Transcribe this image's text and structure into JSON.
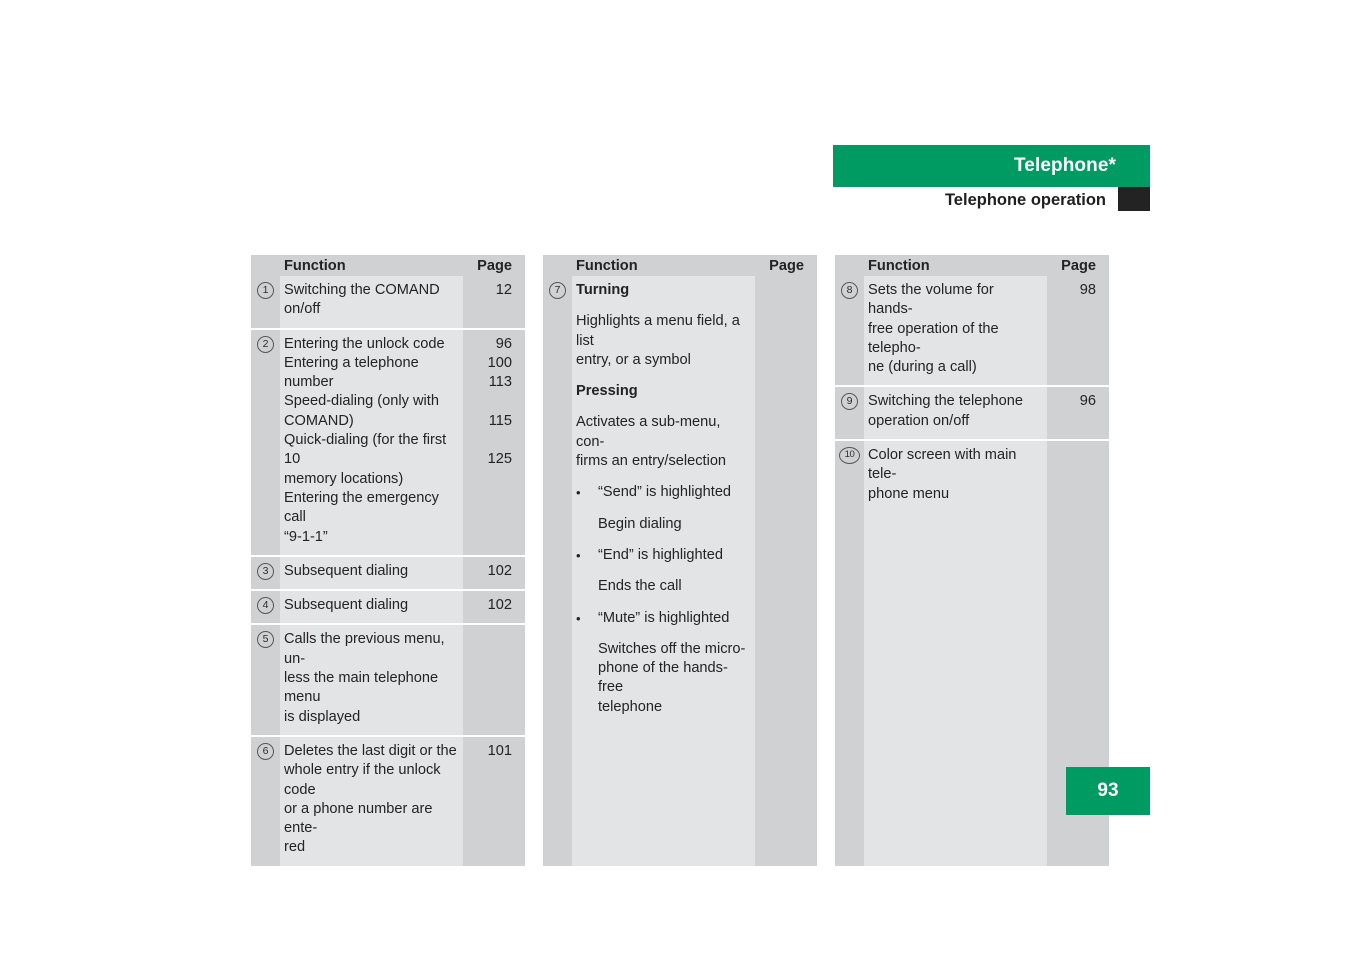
{
  "header": {
    "title": "Telephone*",
    "subtitle": "Telephone operation"
  },
  "footer": {
    "page_number": "93"
  },
  "colors": {
    "accent_green": "#009a63",
    "tab_black": "#232323",
    "cell_bg": "#e3e4e6",
    "gutter_bg": "#d0d1d3"
  },
  "columns": [
    {
      "headers": {
        "function": "Function",
        "page": "Page"
      },
      "rows": [
        {
          "num": "1",
          "lines": [
            "Switching the COMAND",
            "on/off"
          ],
          "pages": "12"
        },
        {
          "num": "2",
          "lines": [
            "Entering the unlock code",
            "Entering a telephone number",
            "Speed-dialing (only with",
            "COMAND)",
            "Quick-dialing (for the first 10",
            "memory locations)",
            "Entering the emergency call",
            "“9-1-1”"
          ],
          "pages": "96\n100\n113\n\n115\n\n125"
        },
        {
          "num": "3",
          "lines": [
            "Subsequent dialing"
          ],
          "pages": "102"
        },
        {
          "num": "4",
          "lines": [
            "Subsequent dialing"
          ],
          "pages": "102"
        },
        {
          "num": "5",
          "lines": [
            "Calls the previous menu, un-",
            "less the main telephone menu",
            "is displayed"
          ],
          "pages": ""
        },
        {
          "num": "6",
          "lines": [
            "Deletes the last digit or the",
            "whole entry if the unlock code",
            "or a phone number are ente-",
            "red"
          ],
          "pages": "101"
        }
      ]
    },
    {
      "headers": {
        "function": "Function",
        "page": "Page"
      },
      "rows": [
        {
          "num": "7",
          "blocks": [
            {
              "kind": "bold",
              "text": "Turning"
            },
            {
              "kind": "para",
              "lines": [
                "Highlights a menu field, a list",
                "entry, or a symbol"
              ]
            },
            {
              "kind": "bold-gap",
              "text": "Pressing"
            },
            {
              "kind": "para",
              "lines": [
                "Activates a sub-menu, con-",
                "firms an entry/selection"
              ]
            },
            {
              "kind": "bullet",
              "text": "“Send” is highlighted"
            },
            {
              "kind": "sub",
              "lines": [
                "Begin dialing"
              ]
            },
            {
              "kind": "bullet",
              "text": "“End” is highlighted"
            },
            {
              "kind": "sub",
              "lines": [
                "Ends the call"
              ]
            },
            {
              "kind": "bullet",
              "text": "“Mute” is highlighted"
            },
            {
              "kind": "sub",
              "lines": [
                "Switches off the micro-",
                "phone of the hands-free",
                "telephone"
              ]
            }
          ],
          "pages": ""
        }
      ]
    },
    {
      "headers": {
        "function": "Function",
        "page": "Page"
      },
      "rows": [
        {
          "num": "8",
          "lines": [
            "Sets the volume for hands-",
            "free operation of the telepho-",
            "ne (during a call)"
          ],
          "pages": "98"
        },
        {
          "num": "9",
          "lines": [
            "Switching the telephone",
            "operation on/off"
          ],
          "pages": "96"
        },
        {
          "num": "10",
          "lines": [
            "Color screen with main tele-",
            "phone menu"
          ],
          "pages": ""
        }
      ]
    }
  ]
}
